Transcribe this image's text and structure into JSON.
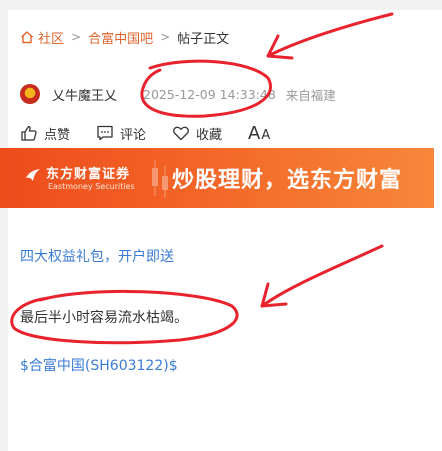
{
  "breadcrumb": {
    "home_icon": "home-icon",
    "items": [
      "社区",
      "合富中国吧",
      "帖子正文"
    ],
    "separator": ">"
  },
  "post_meta": {
    "author": "乂牛魔王乂",
    "time": "2025-12-09 14:33:48",
    "location": "来自福建"
  },
  "actions": {
    "like": "点赞",
    "comment": "评论",
    "favorite": "收藏",
    "font_big": "A",
    "font_small": "A"
  },
  "banner": {
    "brand_cn": "东方财富证券",
    "brand_en": "Eastmoney Securities",
    "slogan": "炒股理财，选东方财富"
  },
  "post": {
    "promo_link": "四大权益礼包，开户即送",
    "content": "最后半小时容易流水枯竭。",
    "stock_tag": "$合富中国(SH603122)$"
  },
  "colors": {
    "accent": "#e0642e",
    "link": "#3a7bd5",
    "annotation": "#e8232e"
  }
}
